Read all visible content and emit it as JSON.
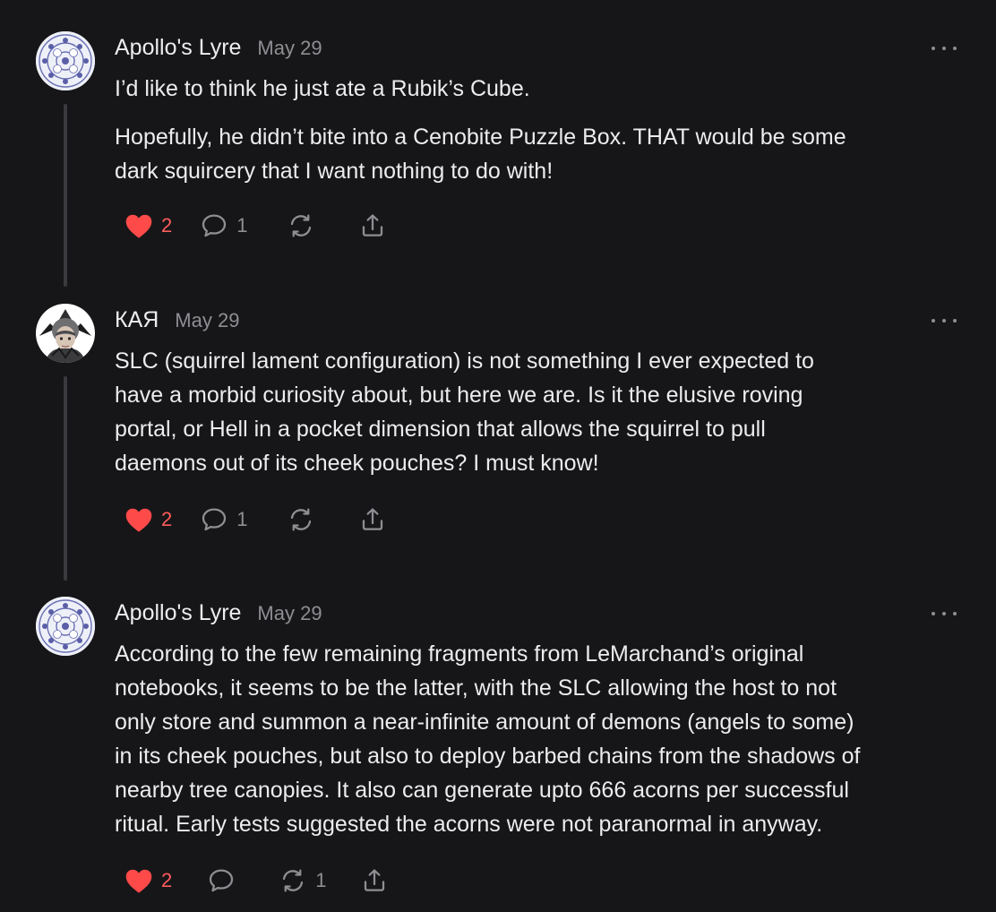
{
  "comments": [
    {
      "author": "Apollo's Lyre",
      "date": "May 29",
      "paragraphs": [
        [
          "I’d like to think he just ate a Rubik’s Cube."
        ],
        [
          "Hopefully, he didn’t bite into a Cenobite Puzzle Box. THAT would be some",
          "dark squircery that I want nothing to do with!"
        ]
      ],
      "likes": "2",
      "replies": "1",
      "restacks": "",
      "liked": true
    },
    {
      "author": "КАЯ",
      "date": "May 29",
      "paragraphs": [
        [
          "SLC (squirrel lament configuration) is not something I ever expected to",
          "have a morbid curiosity about, but here we are. Is it the elusive roving",
          "portal, or Hell in a pocket dimension that allows the squirrel to pull",
          "daemons out of its cheek pouches? I must know!"
        ]
      ],
      "likes": "2",
      "replies": "1",
      "restacks": "",
      "liked": true
    },
    {
      "author": "Apollo's Lyre",
      "date": "May 29",
      "paragraphs": [
        [
          "According to the few remaining fragments from LeMarchand’s original",
          "notebooks, it seems to be the latter, with the SLC allowing the host to not",
          "only store and summon a near-infinite amount of demons (angels to some)",
          "in its cheek pouches, but also to deploy barbed chains from the shadows of",
          "nearby tree canopies. It also can generate upto 666 acorns per successful",
          "ritual. Early tests suggested the acorns were not paranormal in anyway."
        ]
      ],
      "likes": "2",
      "replies": "",
      "restacks": "1",
      "liked": true
    }
  ],
  "colors": {
    "background": "#161618",
    "text": "#ececef",
    "muted": "#8e8e93",
    "like": "#ff5c5c",
    "thread_line": "#3a3a3e"
  },
  "icons": {
    "like": "heart-icon",
    "reply": "speech-bubble-icon",
    "restack": "refresh-arrows-icon",
    "share": "share-upload-icon",
    "more": "ellipsis-icon"
  }
}
